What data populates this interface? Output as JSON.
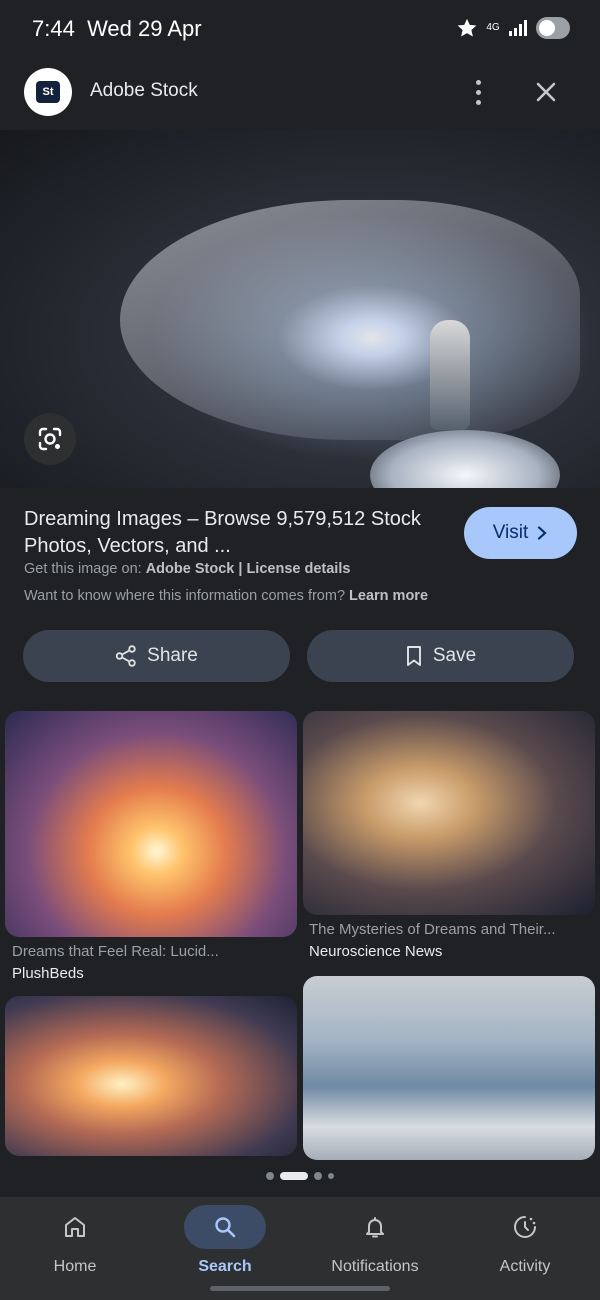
{
  "status_bar": {
    "time": "7:44",
    "date": "Wed 29 Apr",
    "network": "4G",
    "icons": [
      "star-icon",
      "signal-icon",
      "toggle-icon"
    ]
  },
  "header": {
    "logo_text": "St",
    "source_name": "Adobe Stock",
    "icons": [
      "more-vert-icon",
      "close-icon"
    ]
  },
  "result": {
    "title": "Dreaming Images – Browse 9,579,512 Stock Photos, Vectors, and ...",
    "source_prefix": "Get this image on:",
    "source_name": "Adobe Stock",
    "separator": "|",
    "license": "License details",
    "info_question": "Want to know where this information comes from?",
    "learn_more": "Learn more",
    "visit_label": "Visit"
  },
  "actions": {
    "share_label": "Share",
    "save_label": "Save"
  },
  "related": [
    {
      "caption": "Dreams that Feel Real: Lucid...",
      "source": "PlushBeds"
    },
    {
      "caption": "The Mysteries of Dreams and Their...",
      "source": "Neuroscience News"
    },
    {
      "caption": "",
      "source": ""
    },
    {
      "caption": "",
      "source": ""
    }
  ],
  "pager": {
    "pages": 4,
    "active": 1
  },
  "nav": {
    "items": [
      {
        "label": "Home",
        "icon": "home-icon"
      },
      {
        "label": "Search",
        "icon": "search-icon"
      },
      {
        "label": "Notifications",
        "icon": "bell-icon"
      },
      {
        "label": "Activity",
        "icon": "activity-icon"
      }
    ],
    "active": "Search"
  },
  "colors": {
    "background": "#202124",
    "accent": "#a8c7fa",
    "button": "#3c4350",
    "nav_background": "#2d2f31"
  }
}
